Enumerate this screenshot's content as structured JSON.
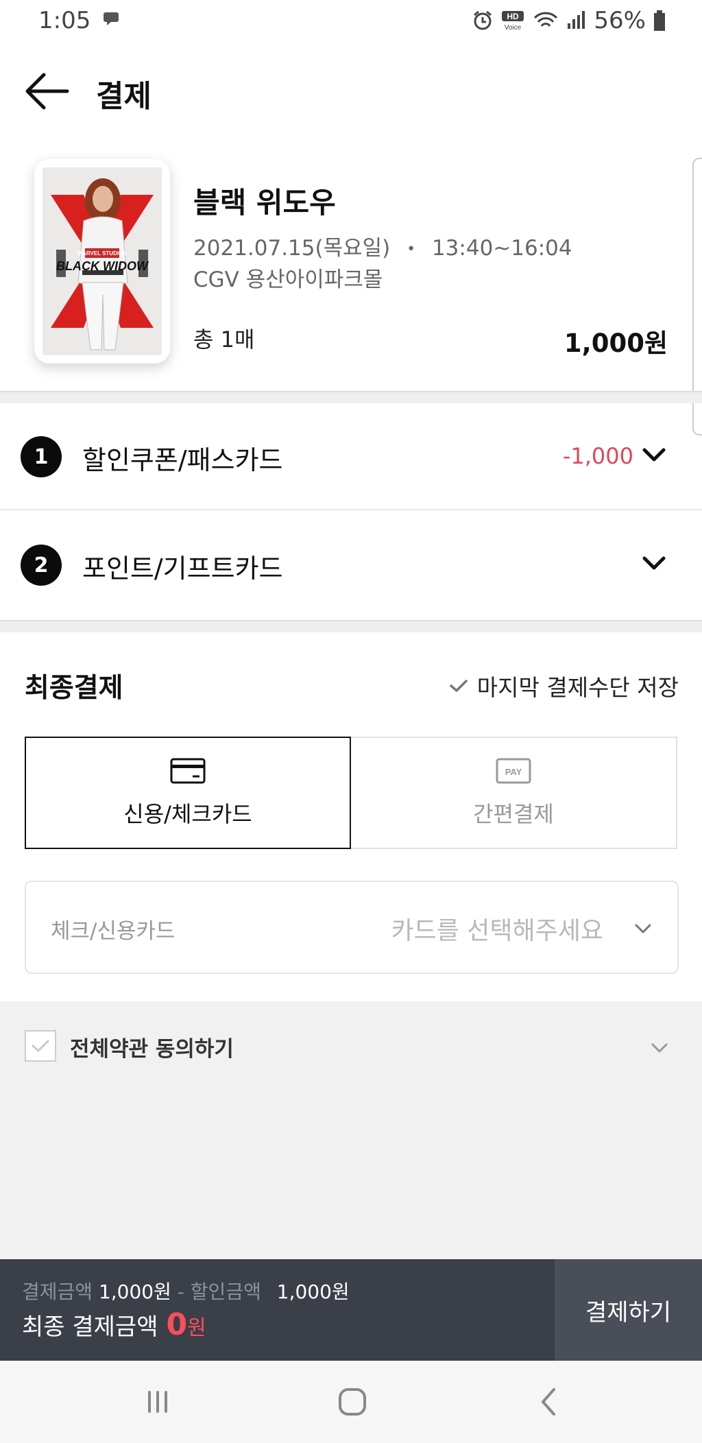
{
  "status_bar": {
    "time": "1:05",
    "battery": "56%",
    "icons": [
      "alarm-icon",
      "hd-voice-icon",
      "wifi-icon",
      "signal-icon",
      "battery-icon"
    ]
  },
  "header": {
    "title": "결제"
  },
  "movie": {
    "title": "블랙 위도우",
    "date": "2021.07.15(목요일)",
    "separator": "•",
    "time": "13:40~16:04",
    "theater": "CGV 용산아이파크몰",
    "count": "총 1매",
    "price": "1,000원",
    "poster_logo_top": "MARVEL STUDIOS",
    "poster_logo": "BLACK WIDOW"
  },
  "sections": [
    {
      "number": "1",
      "label": "할인쿠폰/패스카드",
      "amount": "-1,000"
    },
    {
      "number": "2",
      "label": "포인트/기프트카드",
      "amount": ""
    }
  ],
  "final": {
    "title": "최종결제",
    "save_last": "마지막 결제수단 저장",
    "tabs": [
      {
        "label": "신용/체크카드",
        "icon": "credit-card-icon"
      },
      {
        "label": "간편결제",
        "icon": "pay-icon",
        "icon_text": "PAY"
      }
    ],
    "card_select": {
      "label": "체크/신용카드",
      "placeholder": "카드를 선택해주세요"
    }
  },
  "terms": {
    "label": "전체약관 동의하기"
  },
  "pay_bar": {
    "amount_label": "결제금액",
    "amount_value": "1,000원",
    "minus": "-",
    "discount_label": "할인금액",
    "discount_value": "1,000원",
    "final_label": "최종 결제금액",
    "final_value": "0",
    "final_unit": "원",
    "button": "결제하기"
  },
  "colors": {
    "accent_red": "#ff4d5e",
    "discount_red": "#e0465a",
    "pay_bar_bg": "#3b3f48"
  }
}
